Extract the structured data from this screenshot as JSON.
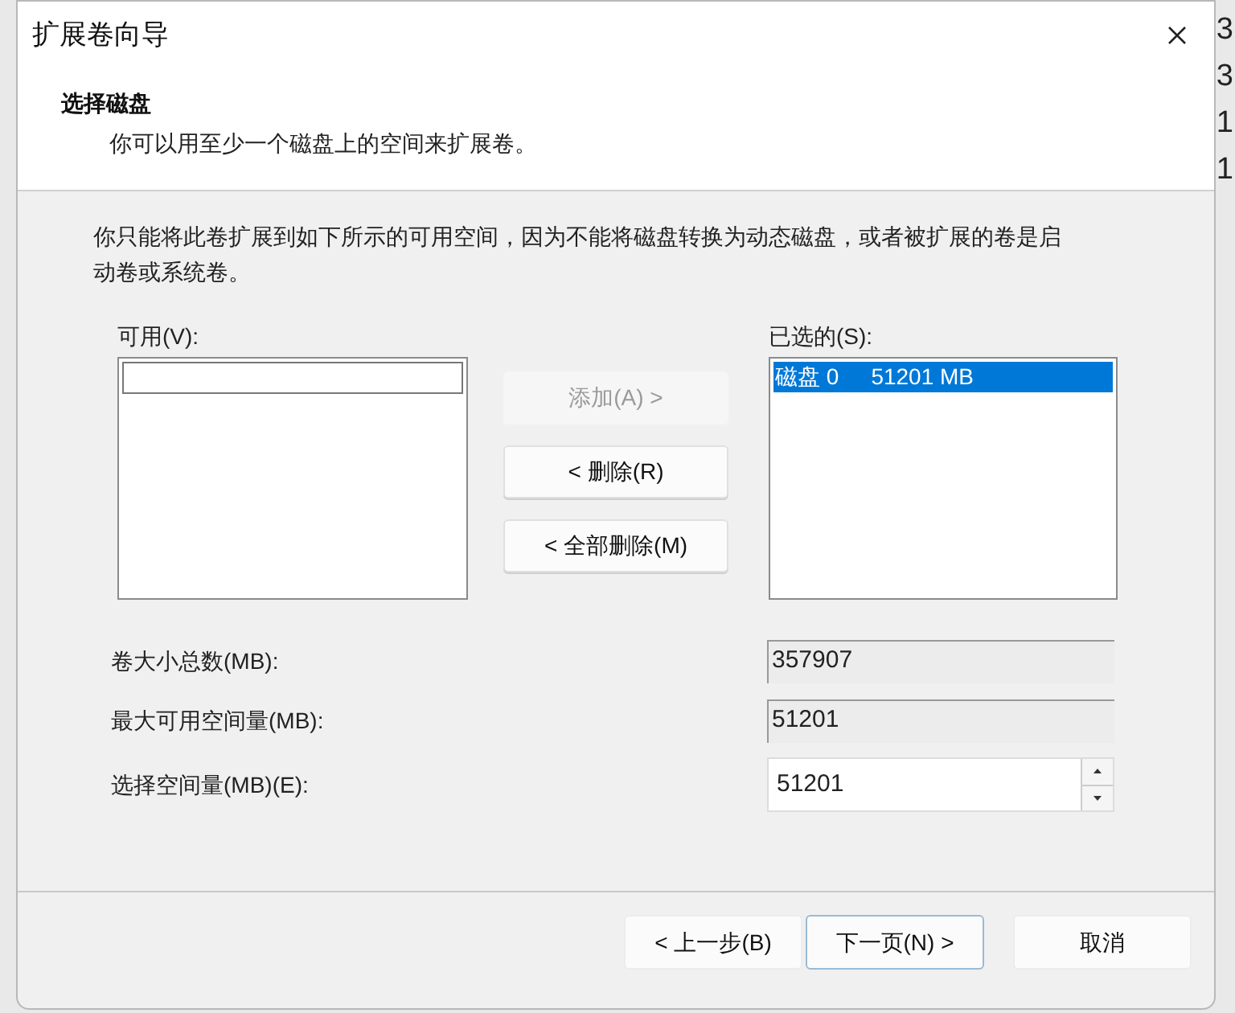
{
  "window": {
    "title": "扩展卷向导"
  },
  "header": {
    "title": "选择磁盘",
    "subtitle": "你可以用至少一个磁盘上的空间来扩展卷。"
  },
  "message": "你只能将此卷扩展到如下所示的可用空间，因为不能将磁盘转换为动态磁盘，或者被扩展的卷是启动卷或系统卷。",
  "available": {
    "label": "可用(V):"
  },
  "selected_list": {
    "label": "已选的(S):",
    "items": [
      {
        "disk": "磁盘 0",
        "size": "51201 MB",
        "selected": true
      }
    ]
  },
  "move_buttons": [
    {
      "label": "添加(A) >",
      "disabled": true
    },
    {
      "label": "< 删除(R)",
      "disabled": false
    },
    {
      "label": "< 全部删除(M)",
      "disabled": false
    }
  ],
  "fields": [
    {
      "label": "卷大小总数(MB):",
      "value": "357907",
      "kind": "readonly"
    },
    {
      "label": "最大可用空间量(MB):",
      "value": "51201",
      "kind": "readonly"
    },
    {
      "label": "选择空间量(MB)(E):",
      "value": "51201",
      "kind": "spin"
    }
  ],
  "footer_buttons": [
    {
      "label": "< 上一步(B)",
      "default": false
    },
    {
      "label": "下一页(N) >",
      "default": true
    },
    {
      "label": "取消",
      "default": false
    }
  ],
  "background_window": {
    "right_edge": [
      "3",
      "3",
      "1",
      "1"
    ]
  }
}
